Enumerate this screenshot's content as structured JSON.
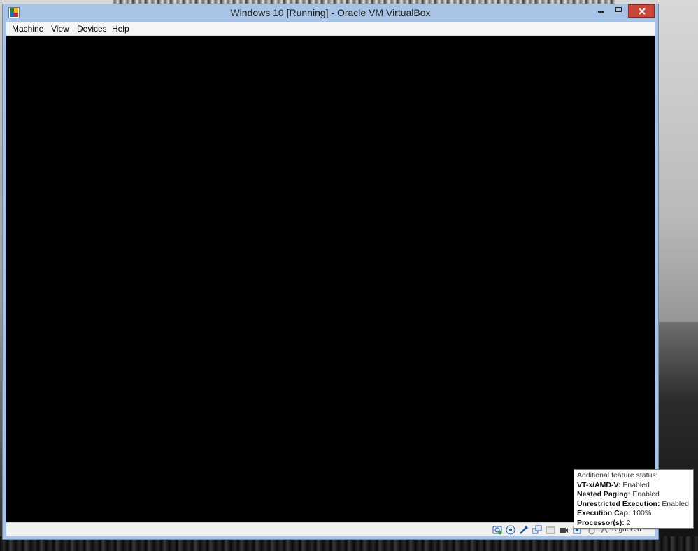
{
  "window": {
    "title": "Windows 10 [Running] - Oracle VM VirtualBox",
    "icon": "virtualbox-icon",
    "controls": {
      "minimize": "minimize-icon",
      "maximize": "maximize-icon",
      "close": "close-icon"
    }
  },
  "menu": {
    "items": [
      {
        "label": "Machine"
      },
      {
        "label": "View"
      },
      {
        "label": "Devices"
      },
      {
        "label": "Help"
      }
    ]
  },
  "statusbar": {
    "icons": [
      "hard-disk-icon",
      "optical-drive-icon",
      "usb-icon",
      "network-icon",
      "shared-folders-icon",
      "video-capture-icon",
      "cpu-feature-icon",
      "mouse-integration-icon",
      "keyboard-icon"
    ],
    "host_key": "Right Ctrl"
  },
  "tooltip": {
    "heading": "Additional feature status:",
    "rows": [
      {
        "label": "VT-x/AMD-V:",
        "value": " Enabled"
      },
      {
        "label": "Nested Paging:",
        "value": " Enabled"
      },
      {
        "label": "Unrestricted Execution:",
        "value": " Enabled"
      },
      {
        "label": "Execution Cap:",
        "value": " 100%"
      },
      {
        "label": "Processor(s):",
        "value": " 2"
      }
    ]
  },
  "colors": {
    "titlebar": "#a7c4e6",
    "close_button": "#c7473b",
    "vm_screen": "#000000",
    "menubar": "#f5f6f7"
  }
}
